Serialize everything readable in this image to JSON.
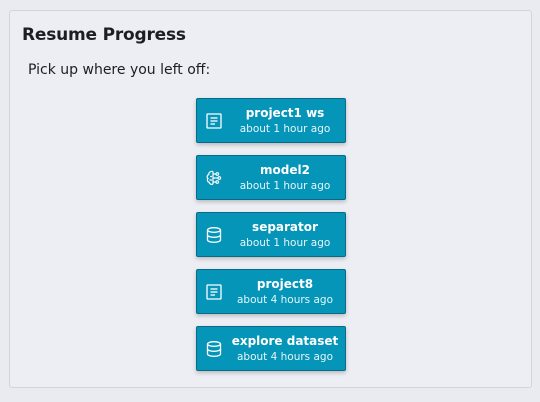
{
  "panel": {
    "title": "Resume Progress",
    "subtitle": "Pick up where you left off:"
  },
  "items": [
    {
      "name": "project1 ws",
      "time": "about 1 hour ago",
      "icon": "notebook-icon"
    },
    {
      "name": "model2",
      "time": "about 1 hour ago",
      "icon": "brain-circuit-icon"
    },
    {
      "name": "separator",
      "time": "about 1 hour ago",
      "icon": "database-icon"
    },
    {
      "name": "project8",
      "time": "about 4 hours ago",
      "icon": "notebook-icon"
    },
    {
      "name": "explore dataset",
      "time": "about 4 hours ago",
      "icon": "database-icon"
    }
  ],
  "colors": {
    "button_bg": "#0595b8",
    "button_border": "#0a6b86",
    "panel_bg": "#eceef4"
  }
}
